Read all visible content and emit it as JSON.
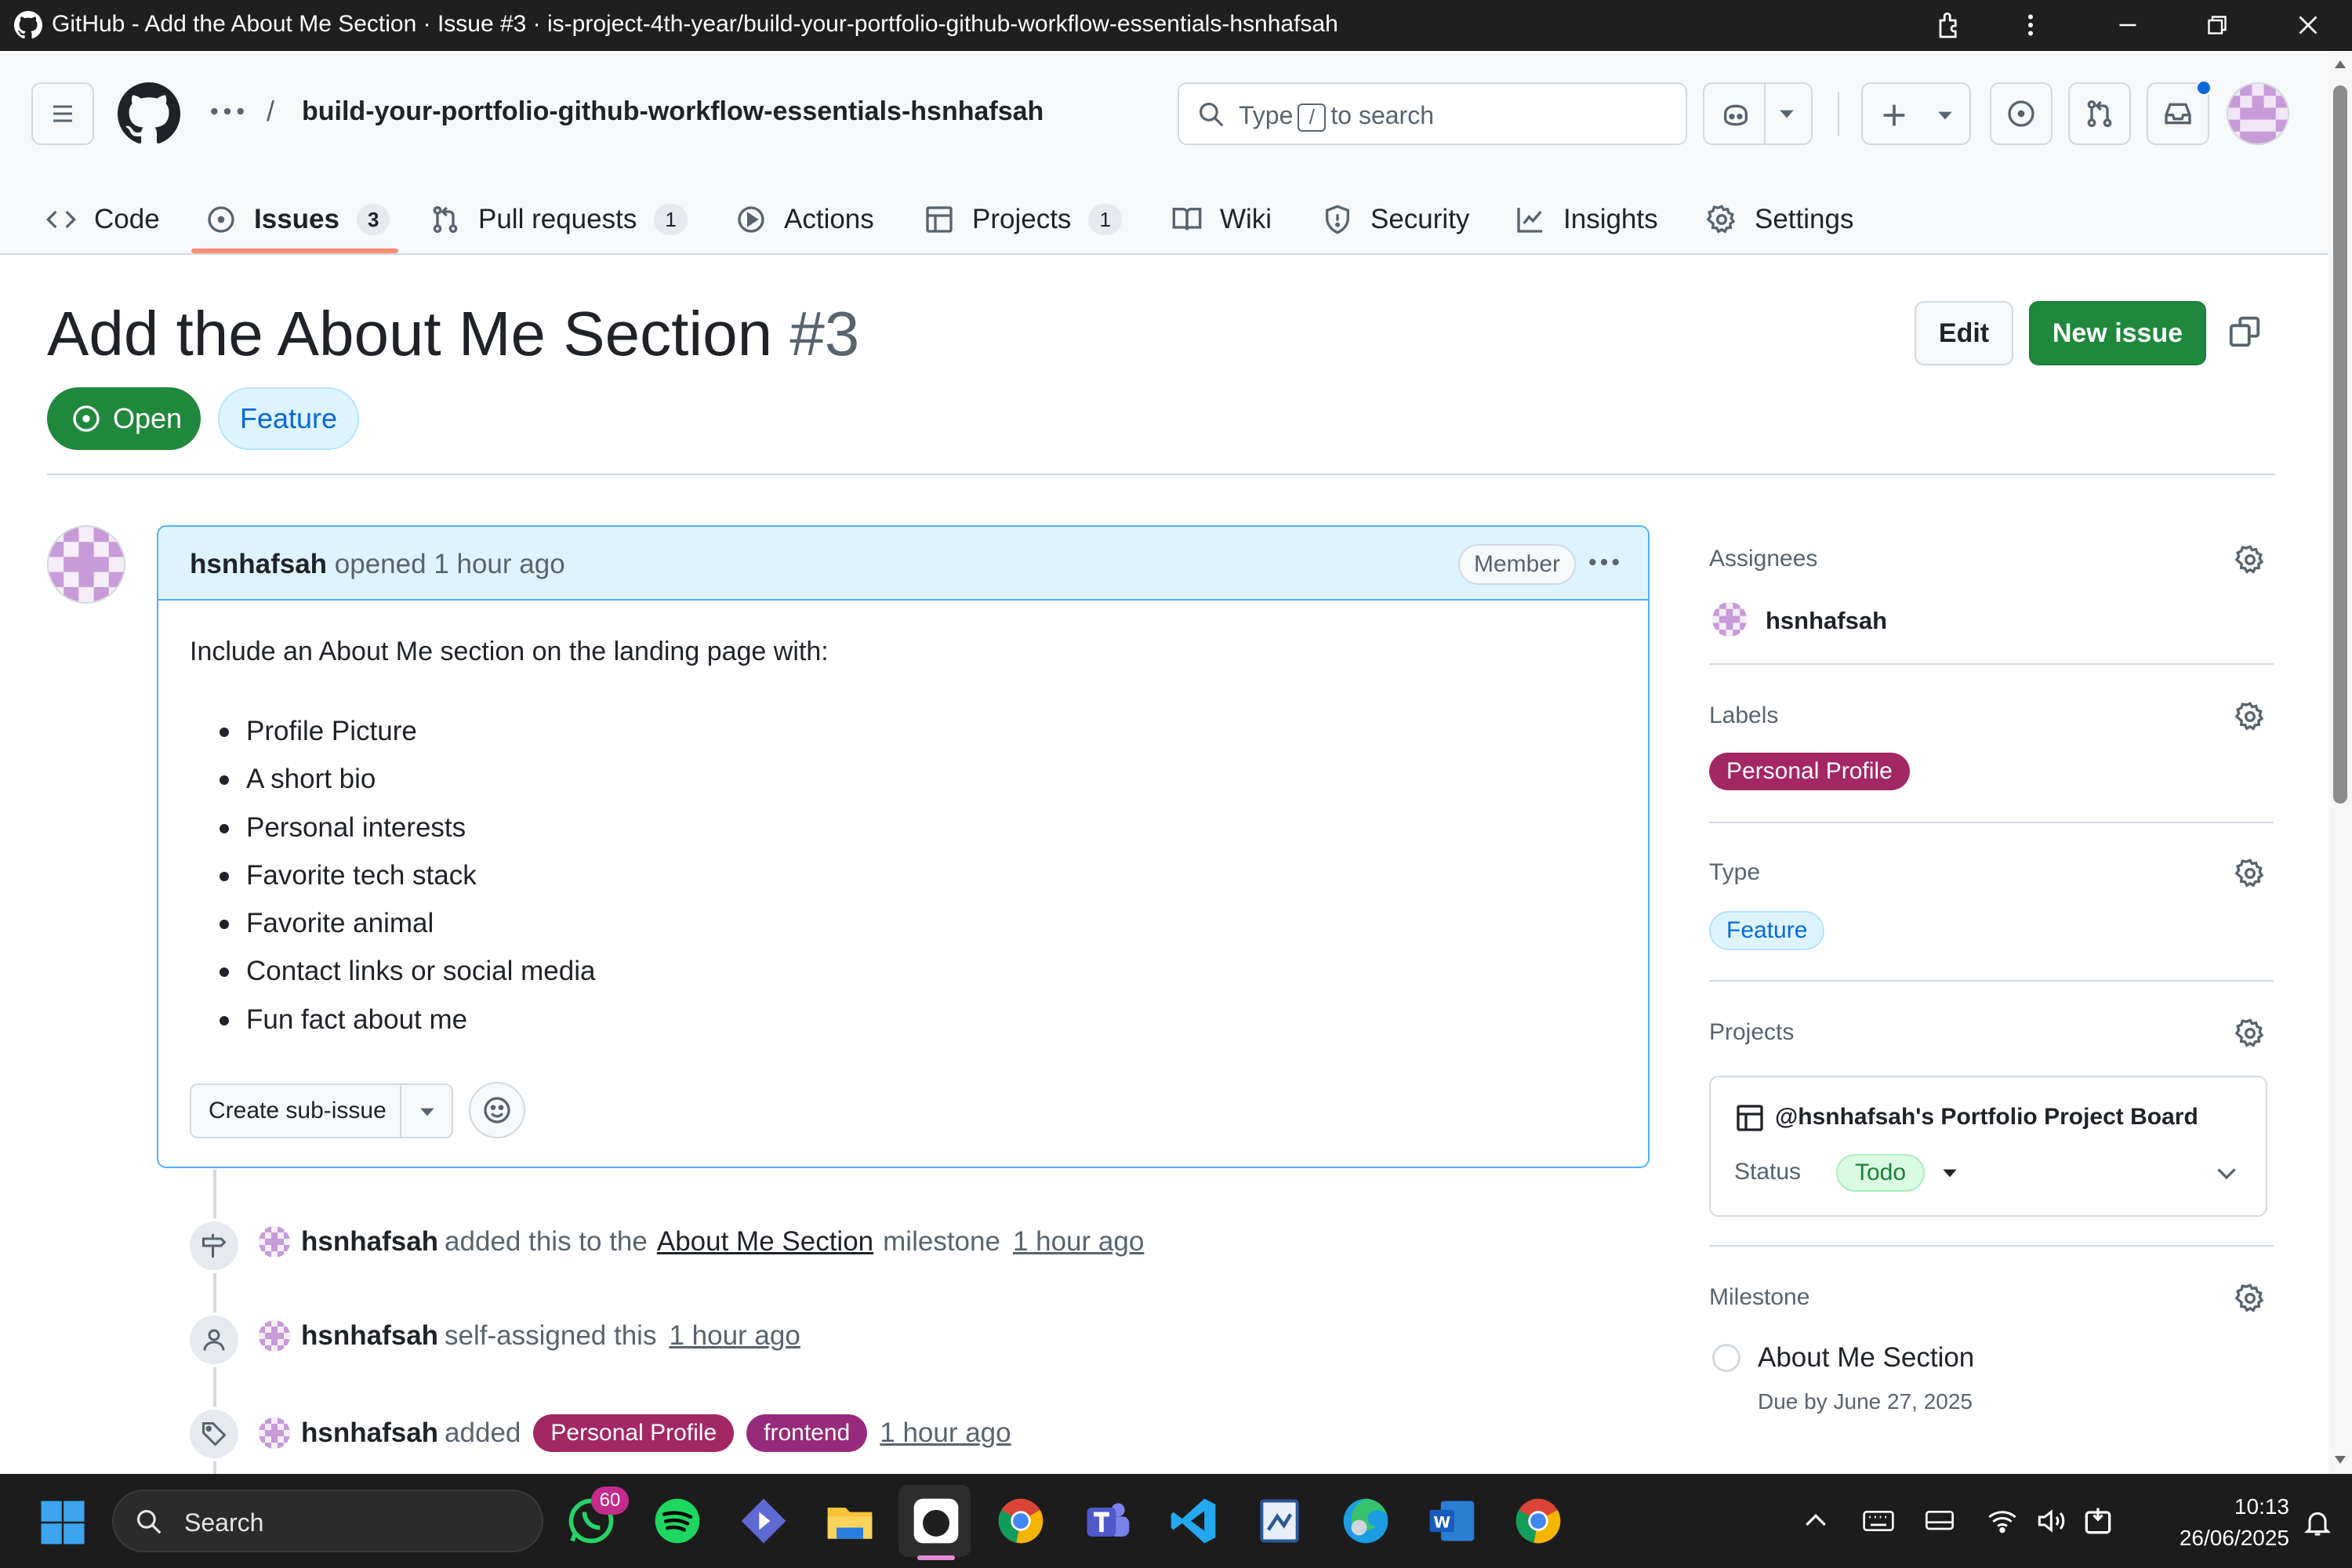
{
  "window": {
    "title": "GitHub - Add the About Me Section · Issue #3 · is-project-4th-year/build-your-portfolio-github-workflow-essentials-hsnhafsah"
  },
  "header": {
    "separator": "/",
    "repo_name": "build-your-portfolio-github-workflow-essentials-hsnhafsah",
    "search_prefix": "Type",
    "search_key": "/",
    "search_suffix": "to search",
    "tabs": [
      {
        "label": "Code",
        "icon": "code-icon"
      },
      {
        "label": "Issues",
        "count": "3",
        "icon": "issue-opened-icon",
        "active": true
      },
      {
        "label": "Pull requests",
        "count": "1",
        "icon": "git-pull-request-icon"
      },
      {
        "label": "Actions",
        "icon": "play-icon"
      },
      {
        "label": "Projects",
        "count": "1",
        "icon": "table-icon"
      },
      {
        "label": "Wiki",
        "icon": "book-icon"
      },
      {
        "label": "Security",
        "icon": "shield-icon"
      },
      {
        "label": "Insights",
        "icon": "graph-icon"
      },
      {
        "label": "Settings",
        "icon": "gear-icon"
      }
    ]
  },
  "issue": {
    "title": "Add the About Me Section",
    "number": "#3",
    "state": "Open",
    "type_pill": "Feature",
    "edit_label": "Edit",
    "new_issue_label": "New issue"
  },
  "comment": {
    "author": "hsnhafsah",
    "action": "opened",
    "time": "1 hour ago",
    "badge": "Member",
    "intro": "Include an About Me section on the landing page with:",
    "bullets": [
      "Profile Picture",
      "A short bio",
      "Personal interests",
      "Favorite tech stack",
      "Favorite animal",
      "Contact links or social media",
      "Fun fact about me"
    ],
    "create_subissue_label": "Create sub-issue"
  },
  "timeline": [
    {
      "icon": "milestone-icon",
      "user": "hsnhafsah",
      "text1": "added this to the",
      "link": "About Me Section",
      "text2": "milestone",
      "time": "1 hour ago"
    },
    {
      "icon": "person-icon",
      "user": "hsnhafsah",
      "text1": "self-assigned this",
      "time": "1 hour ago"
    },
    {
      "icon": "tag-icon",
      "user": "hsnhafsah",
      "text1": "added",
      "labels": [
        "Personal Profile",
        "frontend"
      ],
      "time": "1 hour ago"
    }
  ],
  "sidebar": {
    "assignees": {
      "heading": "Assignees",
      "user": "hsnhafsah"
    },
    "labels": {
      "heading": "Labels",
      "items": [
        "Personal Profile"
      ]
    },
    "type": {
      "heading": "Type",
      "value": "Feature"
    },
    "projects": {
      "heading": "Projects",
      "board": "@hsnhafsah's Portfolio Project Board",
      "status_label": "Status",
      "status_value": "Todo"
    },
    "milestone": {
      "heading": "Milestone",
      "name": "About Me Section",
      "due": "Due by June 27, 2025"
    }
  },
  "taskbar": {
    "search_placeholder": "Search",
    "whatsapp_badge": "60",
    "time": "10:13",
    "date": "26/06/2025"
  },
  "colors": {
    "accent_green": "#1f883d",
    "label_personal_profile": "#a32763",
    "label_frontend": "#972a7b",
    "feature_blue": "#0969da",
    "tab_underline": "#fd8c73"
  }
}
